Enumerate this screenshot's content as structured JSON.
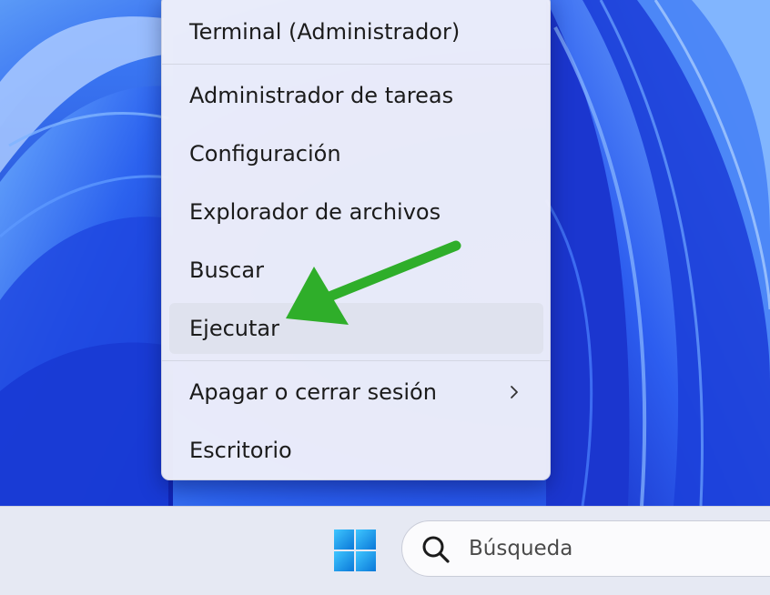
{
  "context_menu": {
    "items": [
      {
        "label": "Terminal (Administrador)"
      },
      {
        "label": "Administrador de tareas"
      },
      {
        "label": "Configuración"
      },
      {
        "label": "Explorador de archivos"
      },
      {
        "label": "Buscar"
      },
      {
        "label": "Ejecutar",
        "highlighted": true
      },
      {
        "label": "Apagar o cerrar sesión",
        "has_submenu": true
      },
      {
        "label": "Escritorio"
      }
    ]
  },
  "taskbar": {
    "search": {
      "placeholder": "Búsqueda"
    },
    "start_icon": "windows-logo-icon"
  },
  "colors": {
    "arrow": "#2fae2a",
    "menu_background": "#eef0fa",
    "highlight": "#dfe2ee",
    "wallpaper_blue": "#1b3bd9"
  }
}
